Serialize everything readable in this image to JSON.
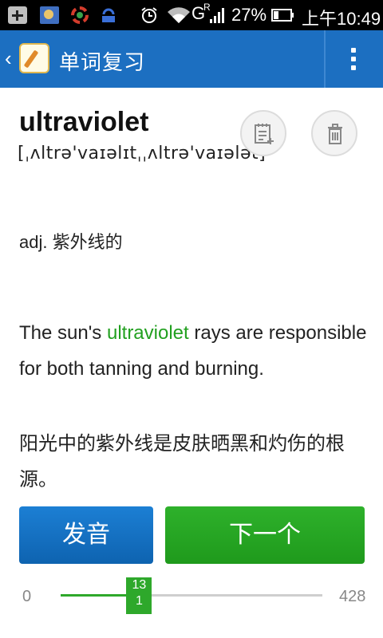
{
  "status_bar": {
    "network": "G",
    "network_sup": "R",
    "battery": "27%",
    "time": "上午10:49"
  },
  "app_bar": {
    "back_glyph": "‹",
    "title": "单词复习",
    "menu_icon": "overflow-menu-icon"
  },
  "card": {
    "word": "ultraviolet",
    "phonetic": "[ˌʌltrə'vaɪəlɪtˌˌʌltrə'vaɪələt]",
    "definition": "adj. 紫外线的",
    "example_before": "The sun's ",
    "example_highlight": "ultraviolet",
    "example_after": " rays are responsible for both tanning and burning.",
    "translation": "阳光中的紫外线是皮肤晒黑和灼伤的根源。",
    "highlight_color": "#22a020"
  },
  "actions": {
    "speak_label": "发音",
    "next_label": "下一个"
  },
  "progress": {
    "min_label": "0",
    "max_label": "428",
    "current_top": "13",
    "current_bottom": "1",
    "fraction": 0.3
  },
  "colors": {
    "app_bar": "#1c6fc1",
    "speak_button": "#1577c8",
    "next_button": "#28a825"
  }
}
